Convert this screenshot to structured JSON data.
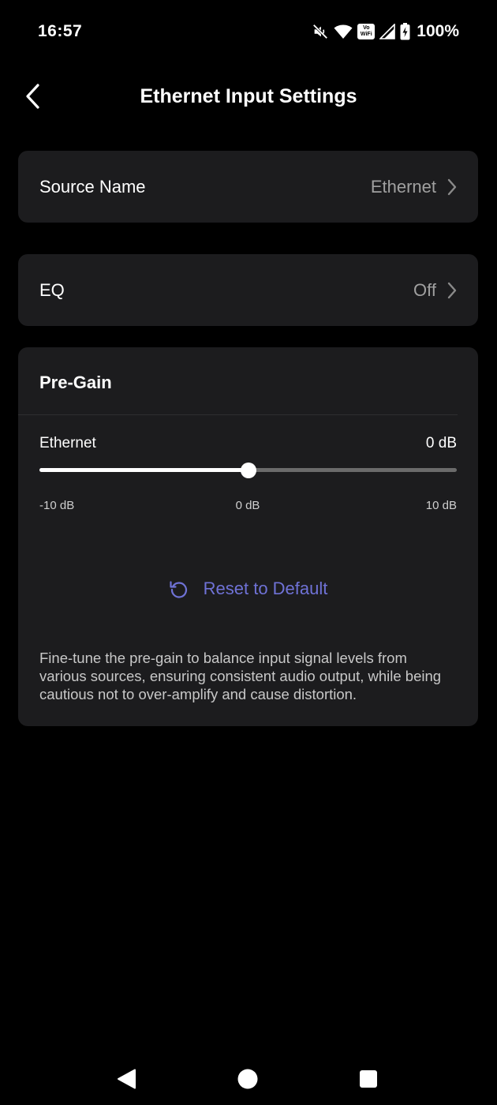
{
  "status_bar": {
    "time": "16:57",
    "vowifi_label": "Vo WiFi",
    "battery": "100%",
    "icons": [
      "mute-icon",
      "wifi-icon",
      "vowifi-icon",
      "signal-icon",
      "battery-charging-icon"
    ]
  },
  "header": {
    "title": "Ethernet Input Settings",
    "back_icon": "chevron-left-icon"
  },
  "source_name": {
    "label": "Source Name",
    "value": "Ethernet"
  },
  "eq": {
    "label": "EQ",
    "value": "Off"
  },
  "pre_gain": {
    "title": "Pre-Gain",
    "channel_label": "Ethernet",
    "current_value_label": "0 dB",
    "slider": {
      "min": -10,
      "max": 10,
      "value": 0
    },
    "ticks": {
      "min": "-10 dB",
      "mid": "0 dB",
      "max": "10 dB"
    },
    "reset_label": "Reset to Default",
    "description": "Fine-tune the pre-gain to balance input signal levels from various sources, ensuring consistent audio output, while being cautious not to over-amplify and cause distortion."
  },
  "colors": {
    "background": "#000000",
    "card": "#1c1c1e",
    "accent": "#6f72d6",
    "secondary_text": "#a0a0a0"
  },
  "nav_bar": {
    "buttons": [
      "back-triangle-icon",
      "home-circle-icon",
      "recents-square-icon"
    ]
  }
}
